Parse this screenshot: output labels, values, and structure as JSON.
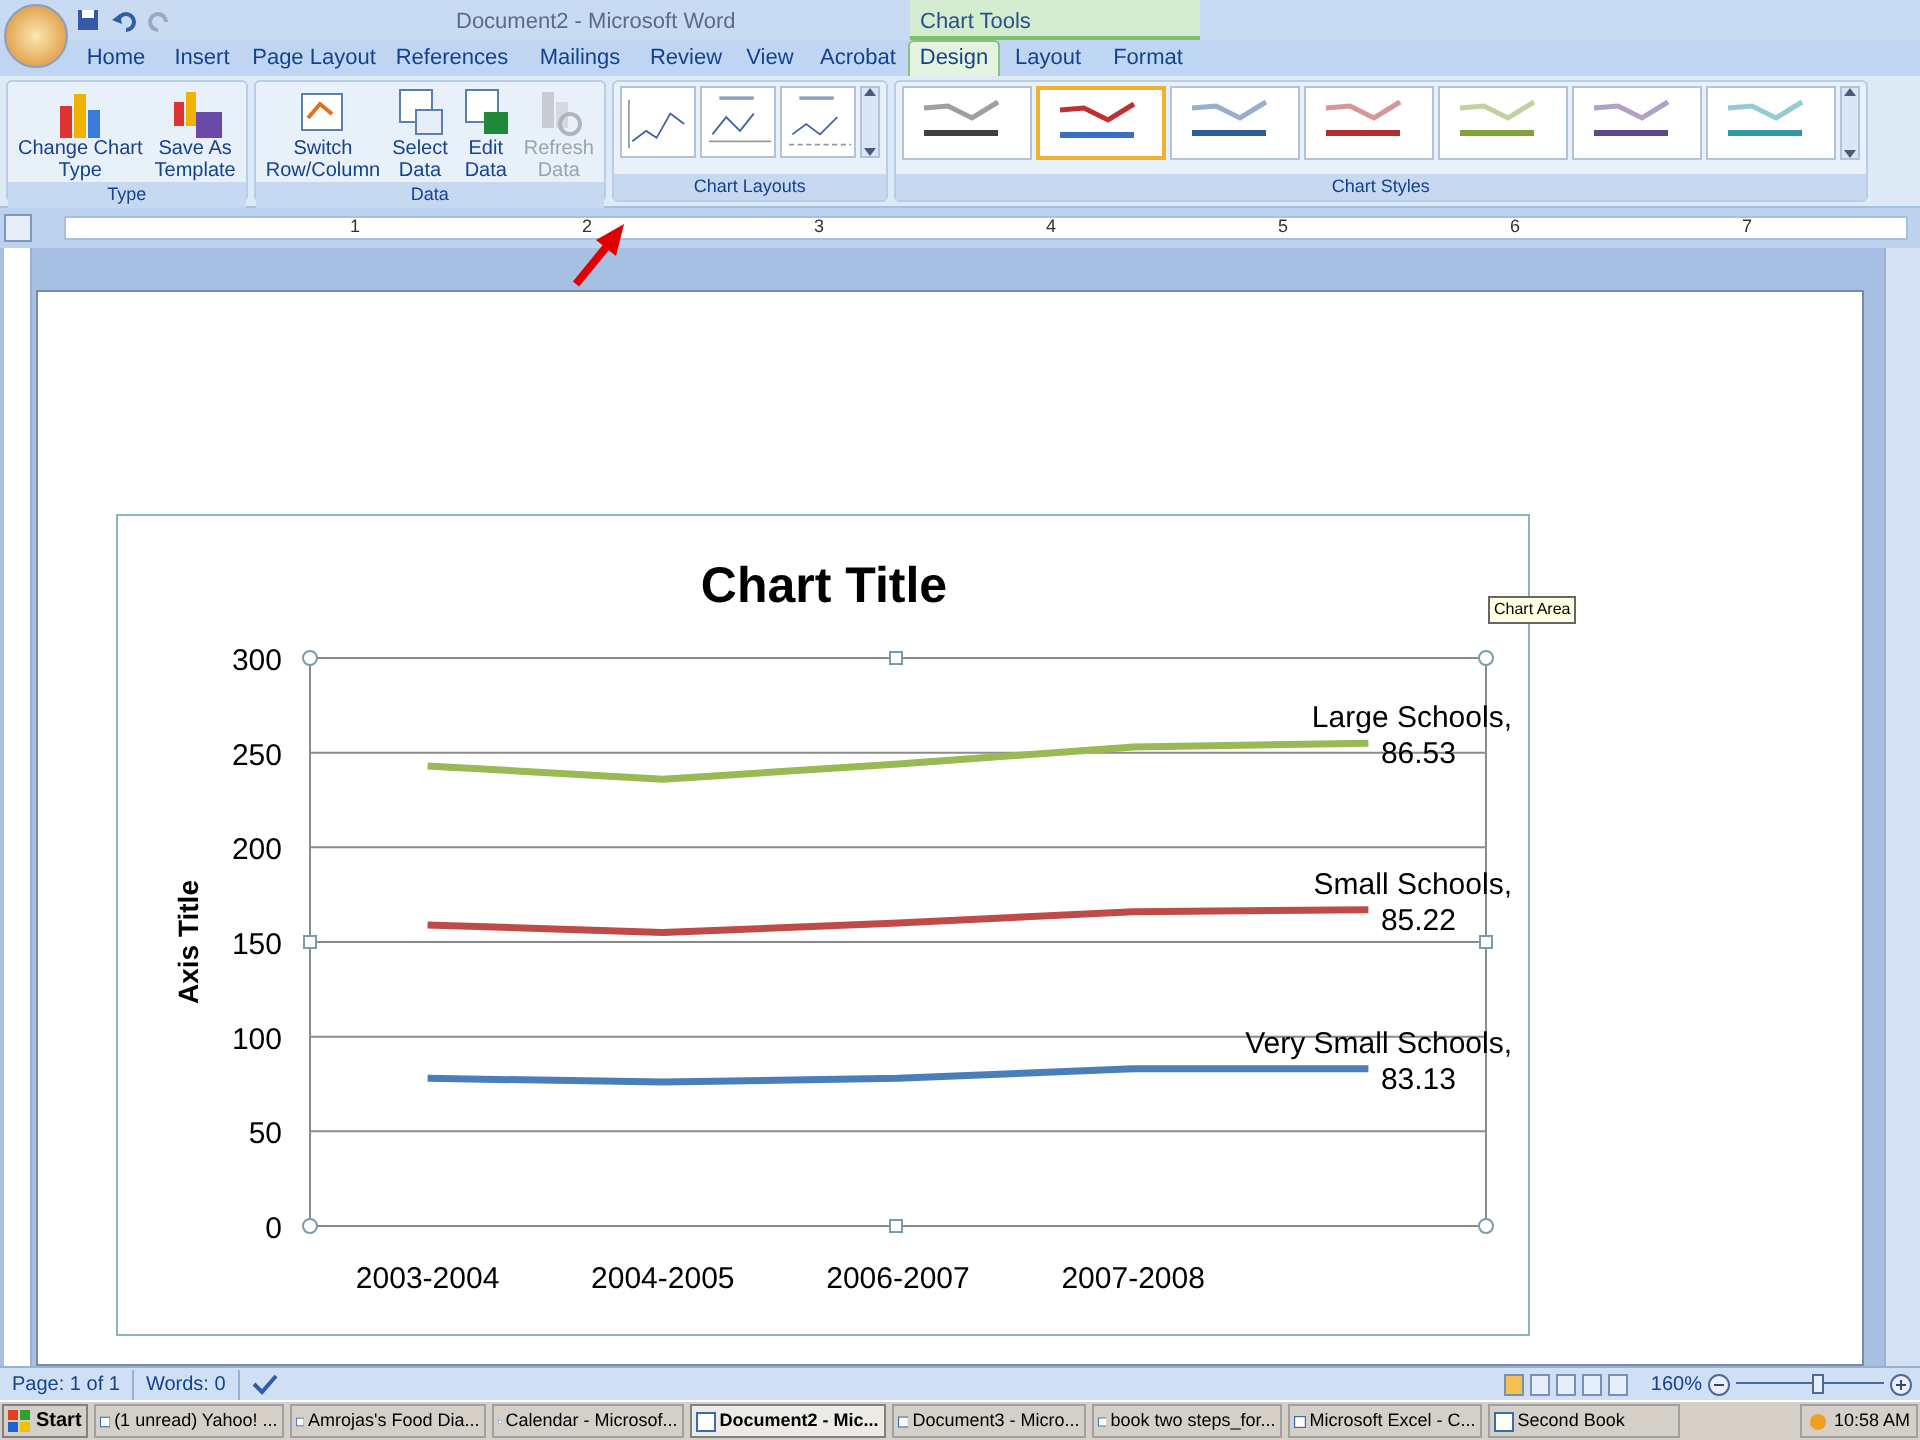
{
  "window": {
    "title": "Document2 - Microsoft Word"
  },
  "contextual_tab_group": "Chart Tools",
  "tabs": [
    {
      "label": "Home",
      "selected": false
    },
    {
      "label": "Insert",
      "selected": false
    },
    {
      "label": "Page Layout",
      "selected": false
    },
    {
      "label": "References",
      "selected": false
    },
    {
      "label": "Mailings",
      "selected": false
    },
    {
      "label": "Review",
      "selected": false
    },
    {
      "label": "View",
      "selected": false
    },
    {
      "label": "Acrobat",
      "selected": false
    },
    {
      "label": "Design",
      "selected": true
    },
    {
      "label": "Layout",
      "selected": false
    },
    {
      "label": "Format",
      "selected": false
    }
  ],
  "ribbon": {
    "groups": [
      {
        "label": "Type",
        "buttons": [
          {
            "label": "Change Chart Type",
            "kind": "change",
            "disabled": false
          },
          {
            "label": "Save As Template",
            "kind": "template",
            "disabled": false
          }
        ]
      },
      {
        "label": "Data",
        "buttons": [
          {
            "label": "Switch Row/Column",
            "kind": "switch",
            "disabled": false
          },
          {
            "label": "Select Data",
            "kind": "select",
            "disabled": false
          },
          {
            "label": "Edit Data",
            "kind": "edit",
            "disabled": false
          },
          {
            "label": "Refresh Data",
            "kind": "refresh",
            "disabled": true
          }
        ]
      },
      {
        "label": "Chart Layouts",
        "kind": "layouts"
      },
      {
        "label": "Chart Styles",
        "kind": "styles",
        "styles": [
          {
            "selected": false,
            "color": "#404040"
          },
          {
            "selected": true,
            "color": "#3a6fc0"
          },
          {
            "selected": false,
            "color": "#2f5d9c"
          },
          {
            "selected": false,
            "color": "#b03030"
          },
          {
            "selected": false,
            "color": "#7fa33a"
          },
          {
            "selected": false,
            "color": "#60468a"
          },
          {
            "selected": false,
            "color": "#2f97a8"
          }
        ]
      }
    ]
  },
  "ruler": {
    "numbers": [
      "1",
      "2",
      "3",
      "4",
      "5",
      "6",
      "7"
    ]
  },
  "chart": {
    "tooltip": "Chart Area",
    "chart_data": {
      "type": "line",
      "title": "Chart Title",
      "ylabel": "Axis Title",
      "categories": [
        "2003-2004",
        "2004-2005",
        "2006-2007",
        "2007-2008",
        null
      ],
      "ylim": [
        0,
        300
      ],
      "yticks": [
        0,
        50,
        100,
        150,
        200,
        250,
        300
      ],
      "series": [
        {
          "name": "Very Small Schools",
          "color": "#4a7ebb",
          "values": [
            78,
            76,
            78,
            83,
            83
          ]
        },
        {
          "name": "Small Schools",
          "color": "#be4b48",
          "values": [
            159,
            155,
            160,
            166,
            167
          ]
        },
        {
          "name": "Large Schools",
          "color": "#98b954",
          "values": [
            243,
            236,
            244,
            253,
            255
          ]
        }
      ],
      "grid": true,
      "annotations": [
        "83.13",
        "85.22",
        "86.53"
      ]
    },
    "label_separator": ","
  },
  "status_bar": {
    "items": [
      "Page: 1 of 1",
      "Words: 0"
    ],
    "zoom": "160%",
    "zoom_level": {
      "level": 0.55
    }
  },
  "taskbar": {
    "start": "Start",
    "items": [
      {
        "label": "(1 unread) Yahoo! ...",
        "selected": false
      },
      {
        "label": "Amrojas's Food Dia...",
        "selected": false
      },
      {
        "label": "Calendar - Microsof...",
        "selected": false
      },
      {
        "label": "Document2 - Mic...",
        "selected": true
      },
      {
        "label": "Document3 - Micro...",
        "selected": false
      },
      {
        "label": "book two steps_for...",
        "selected": false
      },
      {
        "label": "Microsoft Excel - C...",
        "selected": false
      },
      {
        "label": "Second Book",
        "selected": false
      }
    ],
    "clock": "10:58 AM"
  }
}
